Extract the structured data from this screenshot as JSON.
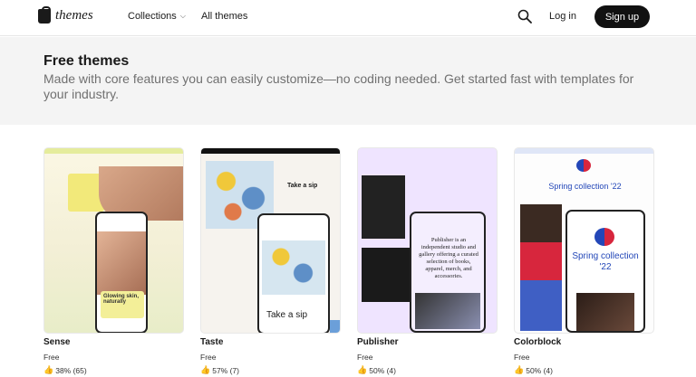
{
  "header": {
    "logo_text": "themes",
    "nav": [
      {
        "label": "Collections"
      },
      {
        "label": "All themes"
      }
    ],
    "login_label": "Log in",
    "signup_label": "Sign up"
  },
  "hero": {
    "title": "Free themes",
    "description": "Made with core features you can easily customize—no coding needed. Get started fast with templates for your industry."
  },
  "themes": [
    {
      "name": "Sense",
      "price": "Free",
      "rating": "38% (65)"
    },
    {
      "name": "Taste",
      "price": "Free",
      "rating": "57% (7)"
    },
    {
      "name": "Publisher",
      "price": "Free",
      "rating": "50% (4)"
    },
    {
      "name": "Colorblock",
      "price": "Free",
      "rating": "50% (4)"
    }
  ],
  "previews": {
    "sense_text": "Glowing skin, naturally",
    "taste_text": "Take a sip",
    "publisher_text": "Publisher is an independent studio and gallery offering a curated selection of books, apparel, merch, and accessories.",
    "colorblock_text": "Spring collection '22",
    "colorblock_small": "Spring collection '22"
  },
  "icons": {
    "search": "search-icon",
    "thumb": "thumbs-up-icon",
    "chevron": "chevron-down-icon"
  }
}
